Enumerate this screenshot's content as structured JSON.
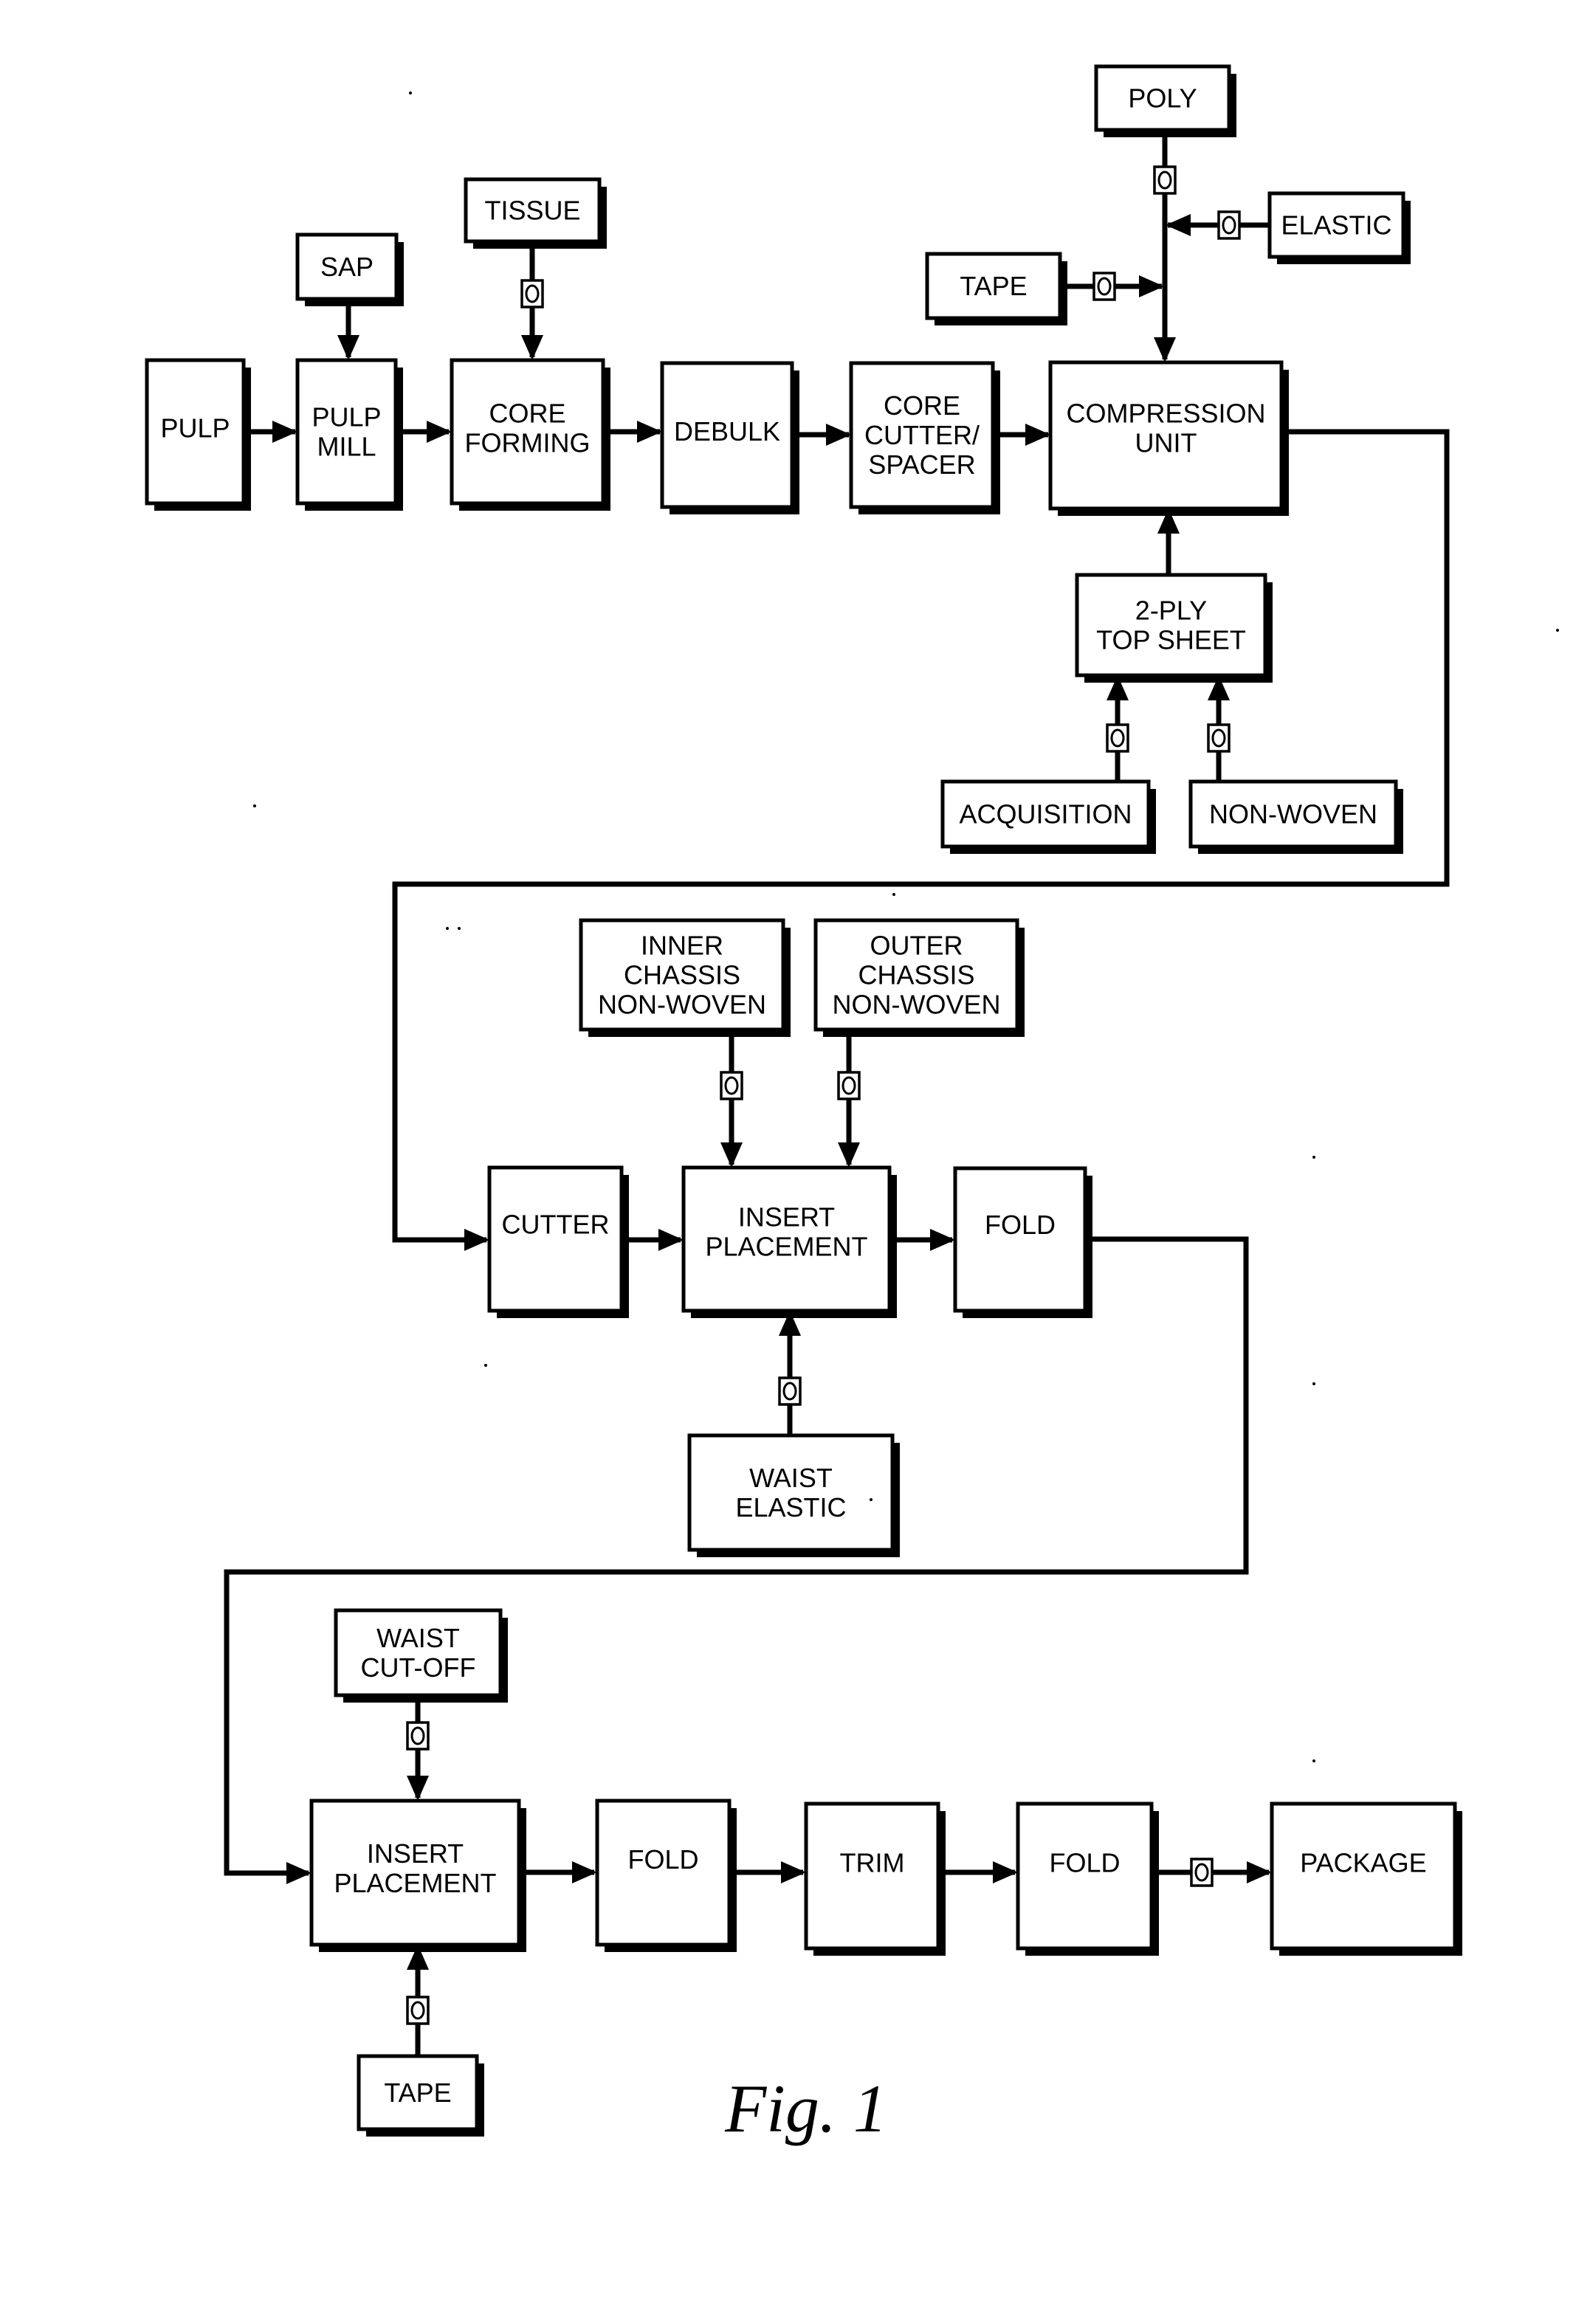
{
  "figure": {
    "caption": "Fig. 1",
    "colors": {
      "ink": "#000000",
      "paper": "#ffffff"
    }
  },
  "nodes": {
    "pulp": [
      "PULP"
    ],
    "sap": [
      "SAP"
    ],
    "pulp_mill": [
      "PULP",
      "MILL"
    ],
    "tissue": [
      "TISSUE"
    ],
    "core_forming": [
      "CORE",
      "FORMING"
    ],
    "debulk": [
      "DEBULK"
    ],
    "core_cutter_spacer": [
      "CORE",
      "CUTTER/",
      "SPACER"
    ],
    "compression_unit": [
      "COMPRESSION",
      "UNIT"
    ],
    "poly": [
      "POLY"
    ],
    "elastic": [
      "ELASTIC"
    ],
    "tape_top": [
      "TAPE"
    ],
    "two_ply_top_sheet": [
      "2-PLY",
      "TOP SHEET"
    ],
    "acquisition": [
      "ACQUISITION"
    ],
    "non_woven": [
      "NON-WOVEN"
    ],
    "inner_chassis": [
      "INNER",
      "CHASSIS",
      "NON-WOVEN"
    ],
    "outer_chassis": [
      "OUTER",
      "CHASSIS",
      "NON-WOVEN"
    ],
    "cutter": [
      "CUTTER"
    ],
    "insert_placement_1": [
      "INSERT",
      "PLACEMENT"
    ],
    "fold_1": [
      "FOLD"
    ],
    "waist_elastic": [
      "WAIST",
      "ELASTIC"
    ],
    "waist_cutoff": [
      "WAIST",
      "CUT-OFF"
    ],
    "insert_placement_2": [
      "INSERT",
      "PLACEMENT"
    ],
    "tape_bottom": [
      "TAPE"
    ],
    "fold_2": [
      "FOLD"
    ],
    "trim": [
      "TRIM"
    ],
    "fold_3": [
      "FOLD"
    ],
    "package": [
      "PACKAGE"
    ]
  },
  "gate_symbol": "O",
  "edges": [
    {
      "from": "pulp",
      "to": "pulp_mill",
      "gate": false
    },
    {
      "from": "sap",
      "to": "pulp_mill",
      "gate": false
    },
    {
      "from": "pulp_mill",
      "to": "core_forming",
      "gate": false
    },
    {
      "from": "tissue",
      "to": "core_forming",
      "gate": true
    },
    {
      "from": "core_forming",
      "to": "debulk",
      "gate": false
    },
    {
      "from": "debulk",
      "to": "core_cutter_spacer",
      "gate": false
    },
    {
      "from": "core_cutter_spacer",
      "to": "compression_unit",
      "gate": false
    },
    {
      "from": "poly",
      "to": "compression_unit",
      "gate": true
    },
    {
      "from": "elastic",
      "to": "compression_unit",
      "gate": true
    },
    {
      "from": "tape_top",
      "to": "compression_unit",
      "gate": true
    },
    {
      "from": "two_ply_top_sheet",
      "to": "compression_unit",
      "gate": false
    },
    {
      "from": "acquisition",
      "to": "two_ply_top_sheet",
      "gate": true
    },
    {
      "from": "non_woven",
      "to": "two_ply_top_sheet",
      "gate": true
    },
    {
      "from": "compression_unit",
      "to": "cutter",
      "gate": false
    },
    {
      "from": "cutter",
      "to": "insert_placement_1",
      "gate": false
    },
    {
      "from": "inner_chassis",
      "to": "insert_placement_1",
      "gate": true
    },
    {
      "from": "outer_chassis",
      "to": "insert_placement_1",
      "gate": true
    },
    {
      "from": "waist_elastic",
      "to": "insert_placement_1",
      "gate": true
    },
    {
      "from": "insert_placement_1",
      "to": "fold_1",
      "gate": false
    },
    {
      "from": "fold_1",
      "to": "insert_placement_2",
      "gate": false
    },
    {
      "from": "waist_cutoff",
      "to": "insert_placement_2",
      "gate": true
    },
    {
      "from": "tape_bottom",
      "to": "insert_placement_2",
      "gate": true
    },
    {
      "from": "insert_placement_2",
      "to": "fold_2",
      "gate": false
    },
    {
      "from": "fold_2",
      "to": "trim",
      "gate": false
    },
    {
      "from": "trim",
      "to": "fold_3",
      "gate": false
    },
    {
      "from": "fold_3",
      "to": "package",
      "gate": true
    }
  ]
}
